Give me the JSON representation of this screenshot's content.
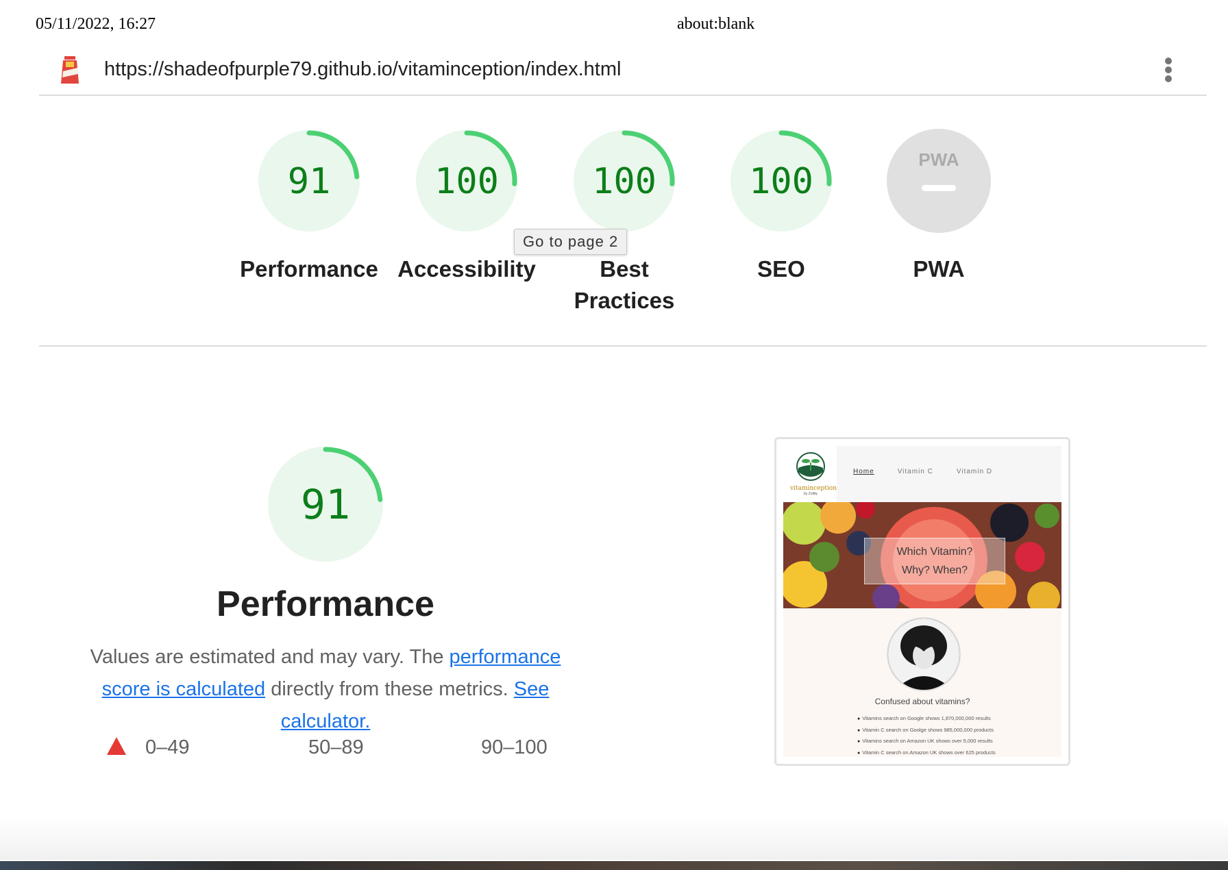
{
  "print_header": {
    "date": "05/11/2022, 16:27",
    "title": "about:blank"
  },
  "topbar": {
    "url": "https://shadeofpurple79.github.io/vitaminception/index.html",
    "logo_icon": "lighthouse-icon",
    "menu_icon": "kebab-menu-icon"
  },
  "gauges": [
    {
      "score": "91",
      "label": "Performance",
      "fraction": 0.91
    },
    {
      "score": "100",
      "label": "Accessibility",
      "fraction": 1.0
    },
    {
      "score": "100",
      "label": "Best Practices",
      "fraction": 1.0
    },
    {
      "score": "100",
      "label": "SEO",
      "fraction": 1.0
    },
    {
      "score": "—",
      "label": "PWA",
      "badge": "PWA"
    }
  ],
  "tooltip": "Go to page 2",
  "performance": {
    "score": "91",
    "title": "Performance",
    "desc_prefix": "Values are estimated and may vary. The ",
    "link_score": "performance score is calculated",
    "desc_middle": " directly from these metrics. ",
    "link_calc": "See calculator."
  },
  "legend": {
    "fail": "0–49",
    "average": "50–89",
    "pass": "90–100"
  },
  "colors": {
    "pass": "#0c7e1a",
    "pass_arc": "#4cd074",
    "pass_bg": "#eaf7ec",
    "fail": "#e53935",
    "link": "#1a73e8"
  },
  "screenshot": {
    "logo_text": "vitaminception",
    "logo_sub": "by Zoltity",
    "nav": [
      "Home",
      "Vitamin C",
      "Vitamin D"
    ],
    "hero_line1": "Which Vitamin?",
    "hero_line2": "Why? When?",
    "confused": "Confused about vitamins?",
    "list": [
      "Vitamins search on Google shows 1,870,000,000 results",
      "Vitamin C search on Goolge shows 985,000,000 products",
      "Vitamins search on Amazon UK shows over 5,000 results",
      "Vitamin C search on Amazon UK shows over 625 products"
    ]
  }
}
